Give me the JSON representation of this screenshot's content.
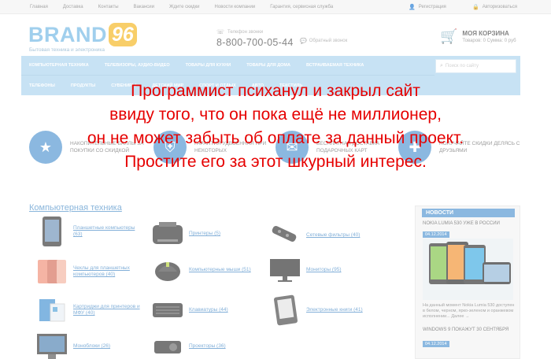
{
  "topbar": {
    "nav": [
      "Главная",
      "Доставка",
      "Контакты",
      "Вакансии",
      "Ждите скидки",
      "Новости компании",
      "Гарантия, сервисная служба"
    ],
    "register": "Регистрация",
    "login": "Авторизоваться"
  },
  "logo": {
    "brand": "BRAND",
    "num": "96",
    "tagline": "Бытовая техника и электроника"
  },
  "phone": {
    "label": "Телефон звонки",
    "number": "8-800-700-05-44"
  },
  "callback": "Обратный звонок",
  "cart": {
    "title": "МОЯ КОРЗИНА",
    "info": "Товаров: 0   Сумма: 0 руб"
  },
  "menu": {
    "row1": [
      "Компьютерная техника",
      "Телевизоры, аудио-видео",
      "Товары для кухни",
      "Товары для дома",
      "Встраиваемая техника"
    ],
    "row2": [
      "Телефоны",
      "Продукты",
      "Сувениры",
      "Детский мир",
      "Спорт и отдых",
      "Авто",
      "Текстиль"
    ],
    "search_placeholder": "Поиск по сайту"
  },
  "features": [
    {
      "text": "Накопительные баллы за покупки со скидкой",
      "icon": "star-icon"
    },
    {
      "text": "Гарантия удвоенная при некоторых",
      "icon": "shield-icon"
    },
    {
      "text": "Бесплатная доставка подарочных карт",
      "icon": "gift-icon"
    },
    {
      "text": "Получайте скидки делясь с друзьями",
      "icon": "share-icon"
    }
  ],
  "section_title": "Компьютерная техника",
  "categories": [
    {
      "label": "Планшетные компьютеры (63)"
    },
    {
      "label": "Принтеры (5)"
    },
    {
      "label": "Сетевые фильтры (40)"
    },
    {
      "label": "Чехлы для планшетных компьютеров (40)"
    },
    {
      "label": "Компьютерные мыши (51)"
    },
    {
      "label": "Мониторы (95)"
    },
    {
      "label": "Картриджи для принтеров и МФУ (40)"
    },
    {
      "label": "Клавиатуры (44)"
    },
    {
      "label": "Электронные книги (41)"
    },
    {
      "label": "Моноблоки (26)"
    },
    {
      "label": "Проекторы (36)"
    }
  ],
  "news": {
    "head": "НОВОСТИ",
    "title1": "NOKIA LUMIA 530 УЖЕ В РОССИИ",
    "date1": "04.12.2014",
    "desc": "На данный момент Nokia Lumia 530 доступен в белом, черном, ярко-зеленом и оранжевом исполнении... Далее →",
    "title2": "WINDOWS 9 ПОКАЖУТ 30 СЕНТЯБРЯ",
    "date2": "04.12.2014"
  },
  "overlay_message": [
    "Программист психанул и закрыл сайт",
    "ввиду того, что он пока ещё не миллионер,",
    "он не может забыть об оплате за данный проект.",
    "Простите его за этот шкурный интерес."
  ]
}
